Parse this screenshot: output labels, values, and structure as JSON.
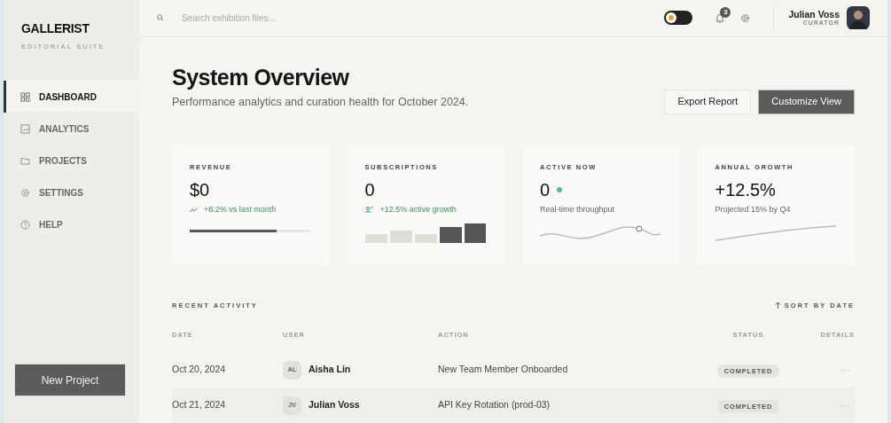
{
  "brand": {
    "name": "GALLERIST",
    "tagline": "EDITORIAL SUITE"
  },
  "sidebar": {
    "items": [
      {
        "label": "DASHBOARD",
        "kind": "grid",
        "selected": true
      },
      {
        "label": "ANALYTICS",
        "kind": "chart",
        "selected": false
      },
      {
        "label": "PROJECTS",
        "kind": "folder",
        "selected": false
      },
      {
        "label": "SETTINGS",
        "kind": "gear",
        "selected": false
      },
      {
        "label": "HELP",
        "kind": "help",
        "selected": false
      }
    ],
    "button": "New Project"
  },
  "topbar": {
    "search": {
      "placeholder": "Search exhibition files..."
    },
    "theme_toggle": {
      "on": false
    },
    "notifications": {
      "count": "3"
    },
    "user": {
      "name": "Julian Voss",
      "role": "CURATOR"
    }
  },
  "header": {
    "title": "System Overview",
    "subtitle": "Performance analytics and curation health for October 2024.",
    "buttons": [
      {
        "label": "Export Report",
        "kind": "outline"
      },
      {
        "label": "Customize View",
        "kind": "dark"
      }
    ]
  },
  "stats": [
    {
      "label": "REVENUE",
      "value": "$0",
      "note": "+8.2% vs last month",
      "kind": "progress",
      "level": 0.72
    },
    {
      "label": "SUBSCRIPTIONS",
      "value": "0",
      "note": "+12.5% active growth",
      "kind": "bars"
    },
    {
      "label": "ACTIVE NOW",
      "value": "0",
      "note": "Real-time throughput",
      "kind": "wave",
      "color": "#4cc36f"
    },
    {
      "label": "ANNUAL GROWTH",
      "value": "+12.5%",
      "note": "Projected 15% by Q4",
      "kind": "trend"
    }
  ],
  "activity": {
    "title": "RECENT ACTIVITY",
    "sort": "SORT BY DATE",
    "columns": [
      "DATE",
      "USER",
      "ACTION",
      "STATUS",
      "DETAILS"
    ],
    "rows": [
      {
        "date": "Oct 20, 2024",
        "initials": "AL",
        "user": "Aisha Lin",
        "action": "New Team Member Onboarded",
        "status": "COMPLETED",
        "details": "···"
      },
      {
        "date": "Oct 21, 2024",
        "initials": "JV",
        "user": "Julian Voss",
        "action": "API Key Rotation (prod-03)",
        "status": "COMPLETED",
        "details": "···"
      }
    ]
  }
}
